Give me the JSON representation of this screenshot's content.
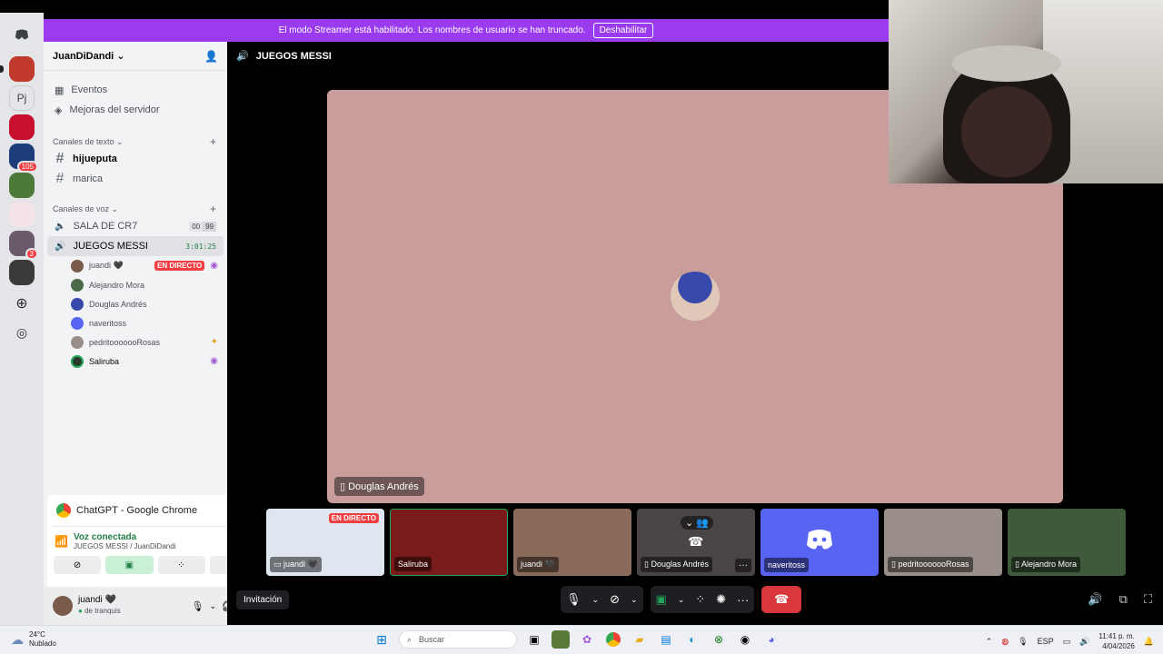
{
  "streamer_bar": {
    "message": "El modo Streamer está habilitado. Los nombres de usuario se han truncado.",
    "disable_label": "Deshabilitar"
  },
  "server": {
    "name": "JuanDiDandi"
  },
  "sidebar": {
    "events": "Eventos",
    "boosts": "Mejoras del servidor",
    "text_category": "Canales de texto",
    "text_channels": [
      "hijueputa",
      "marica"
    ],
    "voice_category": "Canales de voz",
    "voice_channels": [
      {
        "name": "SALA DE CR7",
        "count_a": "00",
        "count_b": "99"
      },
      {
        "name": "JUEGOS MESSI",
        "timer": "3:01:25"
      }
    ],
    "voice_users": [
      {
        "name": "juandi 🖤",
        "live": "EN DIRECTO"
      },
      {
        "name": "Alejandro Mora"
      },
      {
        "name": "Douglas Andrés"
      },
      {
        "name": "naveritoss"
      },
      {
        "name": "pedritooooooRosas"
      },
      {
        "name": "Saliruba"
      }
    ]
  },
  "chrome_panel": {
    "title": "ChatGPT - Google Chrome"
  },
  "voice_panel": {
    "status": "Voz conectada",
    "location": "JUEGOS MESSI / JuanDiDandi"
  },
  "user_panel": {
    "name": "juandi 🖤",
    "status": "de tranquis"
  },
  "main": {
    "channel_title": "JUEGOS MESSI",
    "stage_label": "Douglas Andrés",
    "invite_label": "Invitación",
    "tiles": [
      {
        "name": "juandi 🖤",
        "live": "EN DIRECTO",
        "color": "#dfe6f0"
      },
      {
        "name": "Saliruba",
        "color": "#7a1a1a"
      },
      {
        "name": "juandi 🖤",
        "color": "#8a6a5a"
      },
      {
        "name": "Douglas Andrés",
        "color": "#4a4444"
      },
      {
        "name": "naveritoss",
        "color": "#5865f2"
      },
      {
        "name": "pedritooooooRosas",
        "color": "#9a8f88"
      },
      {
        "name": "Alejandro Mora",
        "color": "#3e5a3a"
      }
    ]
  },
  "taskbar": {
    "temp": "24°C",
    "weather": "Nublado",
    "search_placeholder": "Buscar",
    "lang": "ESP",
    "time": "11:41 p. m.",
    "date": "4/04/2026"
  },
  "colors": {
    "accent": "#5865f2",
    "streamer_purple": "#9b3bf0",
    "live_red": "#f23f42",
    "hangup": "#da373c"
  }
}
